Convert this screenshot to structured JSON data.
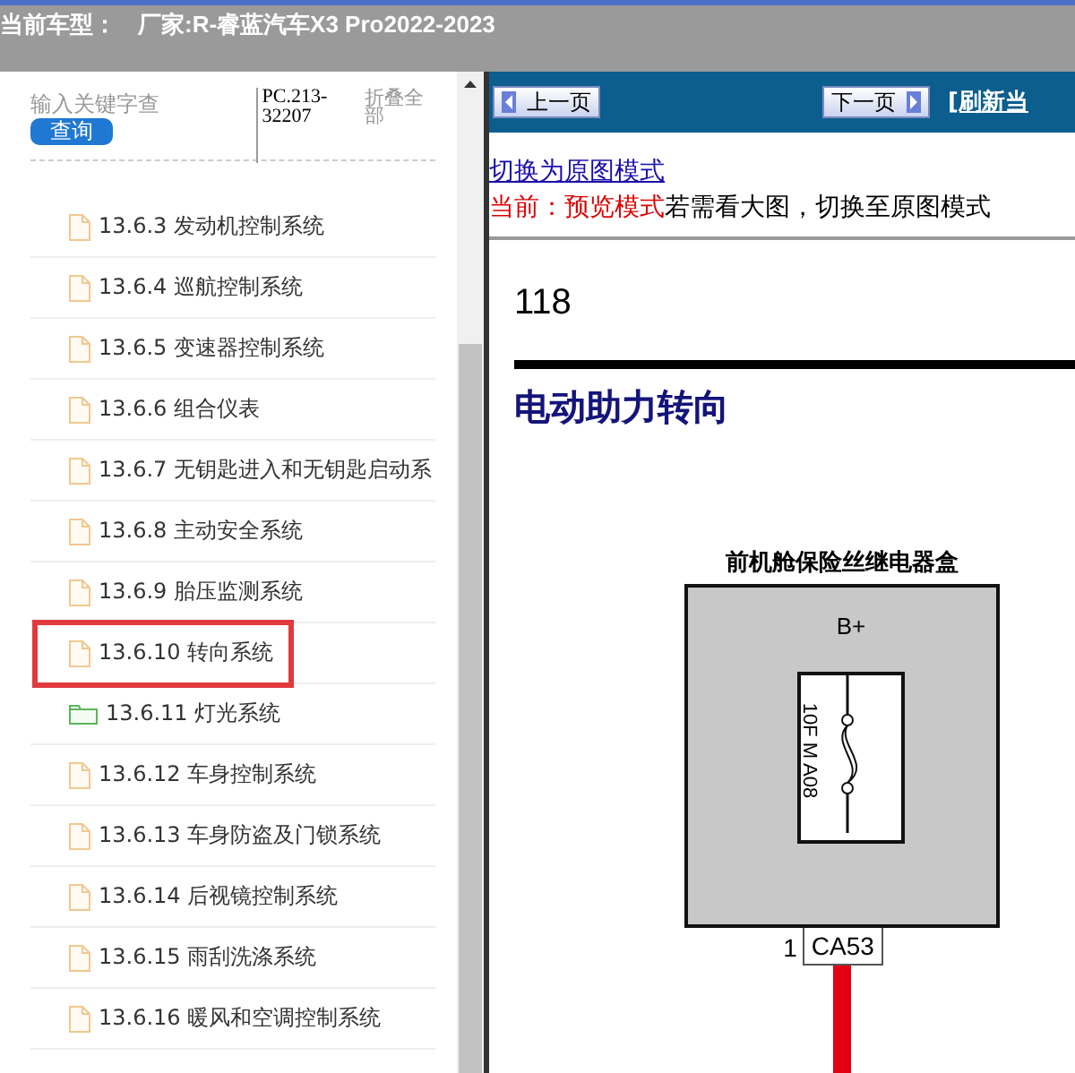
{
  "header": {
    "label": "当前车型：",
    "value": "厂家:R-睿蓝汽车X3 Pro2022-2023"
  },
  "sidebar": {
    "search": {
      "placeholder": "输入关键字查"
    },
    "search_button": "查询",
    "code": "PC.213-32207",
    "collapse_link": "折叠全部",
    "items": [
      {
        "kind": "file",
        "label": "13.6.3 发动机控制系统",
        "selected": false
      },
      {
        "kind": "file",
        "label": "13.6.4 巡航控制系统",
        "selected": false
      },
      {
        "kind": "file",
        "label": "13.6.5 变速器控制系统",
        "selected": false
      },
      {
        "kind": "file",
        "label": "13.6.6 组合仪表",
        "selected": false
      },
      {
        "kind": "file",
        "label": "13.6.7 无钥匙进入和无钥匙启动系",
        "selected": false
      },
      {
        "kind": "file",
        "label": "13.6.8 主动安全系统",
        "selected": false
      },
      {
        "kind": "file",
        "label": "13.6.9 胎压监测系统",
        "selected": false
      },
      {
        "kind": "file",
        "label": "13.6.10 转向系统",
        "selected": true
      },
      {
        "kind": "folder",
        "label": "13.6.11 灯光系统",
        "selected": false
      },
      {
        "kind": "file",
        "label": "13.6.12 车身控制系统",
        "selected": false
      },
      {
        "kind": "file",
        "label": "13.6.13 车身防盗及门锁系统",
        "selected": false
      },
      {
        "kind": "file",
        "label": "13.6.14 后视镜控制系统",
        "selected": false
      },
      {
        "kind": "file",
        "label": "13.6.15 雨刮洗涤系统",
        "selected": false
      },
      {
        "kind": "file",
        "label": "13.6.16 暖风和空调控制系统",
        "selected": false
      }
    ]
  },
  "toolbar": {
    "prev_button": "上一页",
    "next_button": "下一页",
    "refresh_link": "[刷新当"
  },
  "viewer": {
    "mode_link": "切换为原图模式",
    "mode_status": "当前：预览模式",
    "mode_hint": "若需看大图，切换至原图模式",
    "page": {
      "page_number": "118",
      "heading": "电动助力转向",
      "diagram": {
        "box_title": "前机舱保险丝继电器盒",
        "terminal": "B+",
        "fuse_label": "10F M A08",
        "pin": "1",
        "connector": "CA53"
      }
    }
  }
}
